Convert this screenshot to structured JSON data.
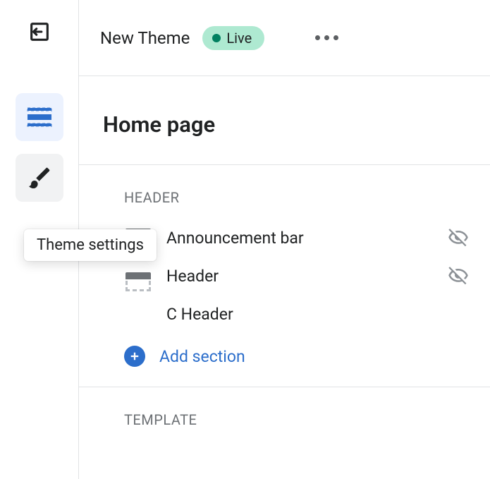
{
  "topbar": {
    "theme_name": "New Theme",
    "status_label": "Live"
  },
  "tooltip": {
    "theme_settings": "Theme settings"
  },
  "page": {
    "title": "Home page"
  },
  "groups": {
    "header": {
      "label": "HEADER",
      "sections": [
        {
          "label": "Announcement bar",
          "hidden": true
        },
        {
          "label": "Header",
          "hidden": true
        },
        {
          "label": "C Header",
          "hidden": false
        }
      ],
      "add_label": "Add section"
    },
    "template": {
      "label": "TEMPLATE"
    }
  }
}
